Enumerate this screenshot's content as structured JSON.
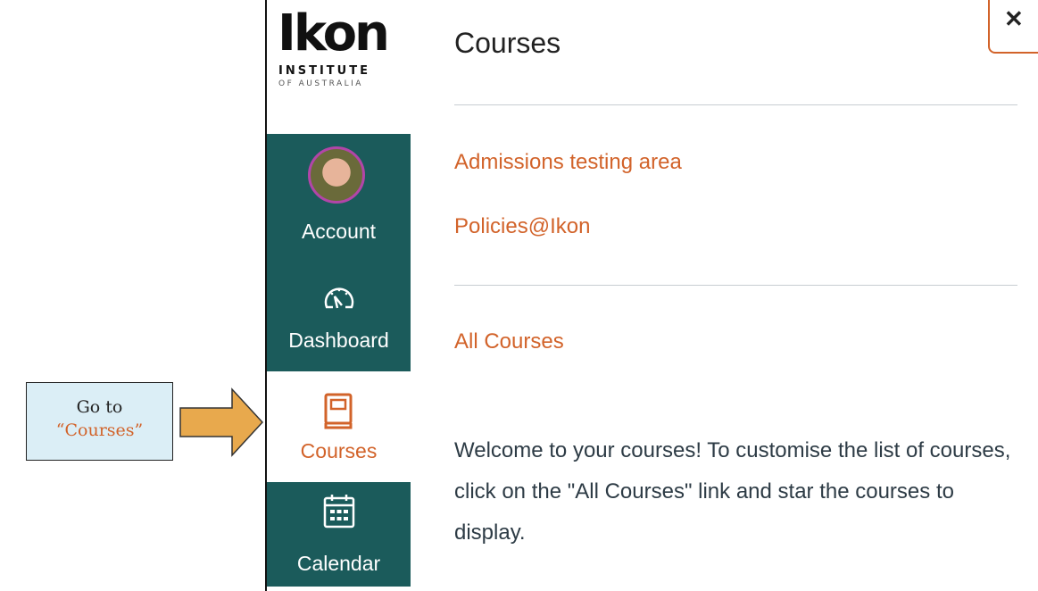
{
  "callout": {
    "line1": "Go to",
    "line2": "“Courses”"
  },
  "logo": {
    "word": "Ikon",
    "sub1": "INSTITUTE",
    "sub2": "OF AUSTRALIA"
  },
  "nav": {
    "account": {
      "label": "Account",
      "icon": "avatar"
    },
    "dashboard": {
      "label": "Dashboard",
      "icon": "speedometer-icon"
    },
    "courses": {
      "label": "Courses",
      "icon": "book-icon"
    },
    "calendar": {
      "label": "Calendar",
      "icon": "calendar-icon"
    }
  },
  "panel": {
    "title": "Courses",
    "close_label": "✕",
    "courses": [
      "Admissions testing area",
      "Policies@Ikon"
    ],
    "all_courses": "All Courses",
    "welcome": "Welcome to your courses! To customise the list of courses, click on the \"All Courses\" link and star the courses to display."
  },
  "colors": {
    "accent": "#d2632a",
    "nav_bg": "#1b5b5b",
    "callout_bg": "#dbeef6",
    "arrow": "#e8a94d"
  }
}
